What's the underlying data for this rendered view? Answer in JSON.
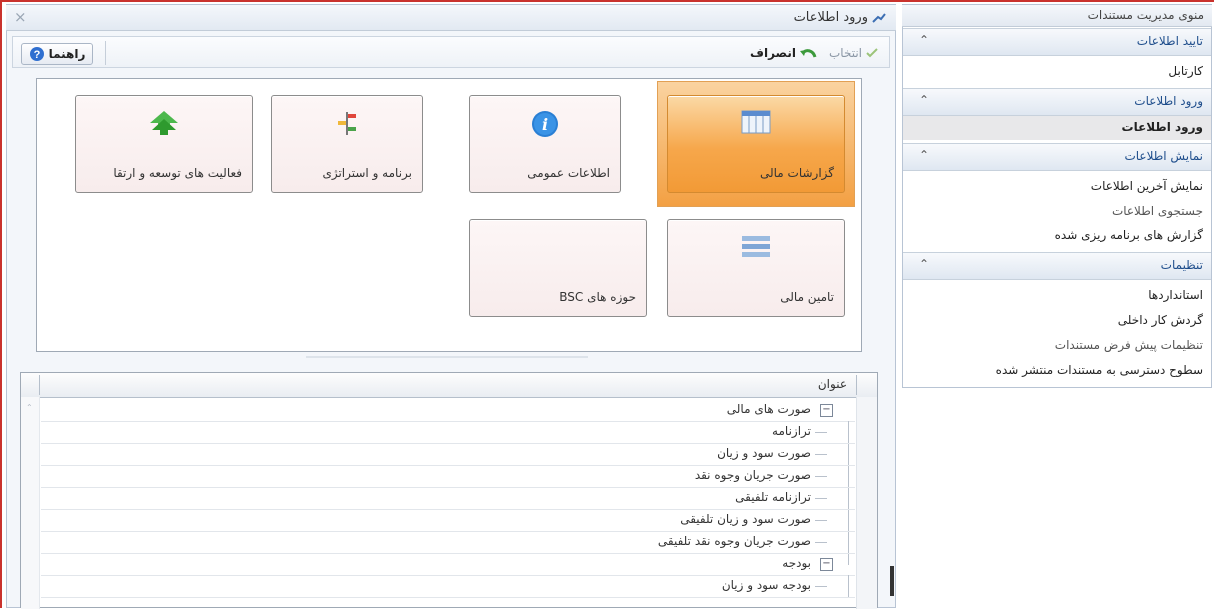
{
  "window": {
    "title": "ورود اطلاعات",
    "close_glyph": "×"
  },
  "toolbar": {
    "select_label": "انتخاب",
    "cancel_label": "انصراف",
    "help_label": "راهنما"
  },
  "tiles": [
    {
      "label": "گزارشات مالی",
      "icon": "grid-icon",
      "active": true
    },
    {
      "label": "اطلاعات عمومی",
      "icon": "info-icon",
      "active": false
    },
    {
      "label": "برنامه و استراتژی",
      "icon": "signpost-icon",
      "active": false
    },
    {
      "label": "فعالیت های توسعه و ارتقا",
      "icon": "arrow-up-tree-icon",
      "active": false
    },
    {
      "label": "تامین مالی",
      "icon": "list-icon",
      "active": false
    },
    {
      "label": "حوزه های BSC",
      "icon": "",
      "active": false
    }
  ],
  "grid": {
    "column_header": "عنوان",
    "rows": [
      {
        "text": "صورت های مالی",
        "level": 0,
        "expanded": true
      },
      {
        "text": "ترازنامه",
        "level": 1
      },
      {
        "text": "صورت سود و زیان",
        "level": 1
      },
      {
        "text": "صورت جریان وجوه نقد",
        "level": 1
      },
      {
        "text": "ترازنامه تلفیقی",
        "level": 1
      },
      {
        "text": "صورت سود و زیان تلفیقی",
        "level": 1
      },
      {
        "text": "صورت جریان وجوه نقد تلفیقی",
        "level": 1
      },
      {
        "text": "بودجه",
        "level": 0,
        "expanded": true
      },
      {
        "text": "بودجه سود و زیان",
        "level": 1
      }
    ]
  },
  "sidebar": {
    "title": "منوی مدیریت مستندات",
    "sections": [
      {
        "label": "تایید اطلاعات",
        "items": [
          {
            "label": "کارتابل",
            "selected": false
          }
        ]
      },
      {
        "label": "ورود اطلاعات",
        "items": [
          {
            "label": "ورود اطلاعات",
            "selected": true
          }
        ]
      },
      {
        "label": "نمایش اطلاعات",
        "items": [
          {
            "label": "نمایش آخرین اطلاعات",
            "selected": false
          },
          {
            "label": "جستجوی اطلاعات",
            "selected": false
          },
          {
            "label": "گزارش های برنامه ریزی شده",
            "selected": false
          }
        ]
      },
      {
        "label": "تنظیمات",
        "items": [
          {
            "label": "استانداردها",
            "selected": false
          },
          {
            "label": "گردش کار داخلی",
            "selected": false
          },
          {
            "label": "تنظیمات پیش فرض مستندات",
            "selected": false
          },
          {
            "label": "سطوح دسترسی به مستندات منتشر شده",
            "selected": false
          }
        ]
      }
    ],
    "collapse_glyph": "⌃"
  },
  "colors": {
    "accent_border": "#c9322d",
    "active_tile": "#f6a74b",
    "section_text": "#1f4e8c"
  }
}
